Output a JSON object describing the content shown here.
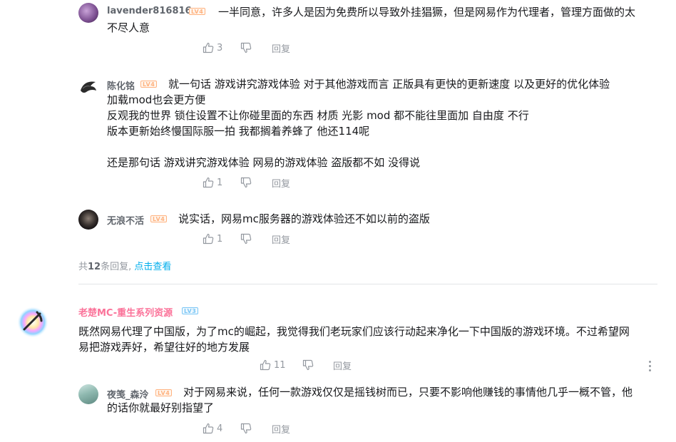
{
  "replies": [
    {
      "username": "lavender816816",
      "level": "LV4",
      "lines": [
        "一半同意，许多人是因为免费所以导致外挂猖獗，但是网易作为代理者，管理方面做的太",
        "不尽人意"
      ],
      "likes": "3",
      "reply_label": "回复"
    },
    {
      "username": "陈化铭",
      "level": "LV4",
      "lines": [
        "就一句话  游戏讲究游戏体验   对于其他游戏而言   正版具有更快的更新速度  以及更好的优化体验",
        "加载mod也会更方便",
        "反观我的世界    锁住设置不让你碰里面的东西    材质  光影   mod  都不能往里面加    自由度 不行",
        "版本更新始终慢国际服一拍    我都搁着养蜂了    他还114呢",
        "",
        "还是那句话   游戏讲究游戏体验    网易的游戏体验  盗版都不如    没得说"
      ],
      "likes": "1",
      "reply_label": "回复"
    },
    {
      "username": "无浪不活",
      "level": "LV4",
      "lines": [
        "说实话，网易mc服务器的游戏体验还不如以前的盗版"
      ],
      "likes": "1",
      "reply_label": "回复"
    }
  ],
  "sub_footer": {
    "prefix": "共",
    "count": "12",
    "middle": "条回复,",
    "link": "点击查看"
  },
  "main_comment": {
    "username": "老楚MC-重生系列资源",
    "level": "LV3",
    "lines": [
      "既然网易代理了中国版，为了mc的崛起，我觉得我们老玩家们应该行动起来净化一下中国版的游戏环境。不过希望网",
      "易把游戏弄好，希望往好的地方发展"
    ],
    "likes": "11",
    "reply_label": "回复"
  },
  "main_reply": {
    "username": "夜笺_森泠",
    "level": "LV4",
    "lines": [
      "对于网易来说，任何一款游戏仅仅是摇钱树而已，只要不影响他赚钱的事情他几乎一概不管，他",
      "的话你就最好别指望了"
    ],
    "likes": "4",
    "reply_label": "回复"
  },
  "colors": {
    "name_gray": "#61666d",
    "name_pink": "#fb7299",
    "text": "#18191c",
    "meta": "#9499a0",
    "link": "#00aeec"
  },
  "icons": [
    "thumbs-up-icon",
    "thumbs-down-icon",
    "more-vertical-icon"
  ]
}
